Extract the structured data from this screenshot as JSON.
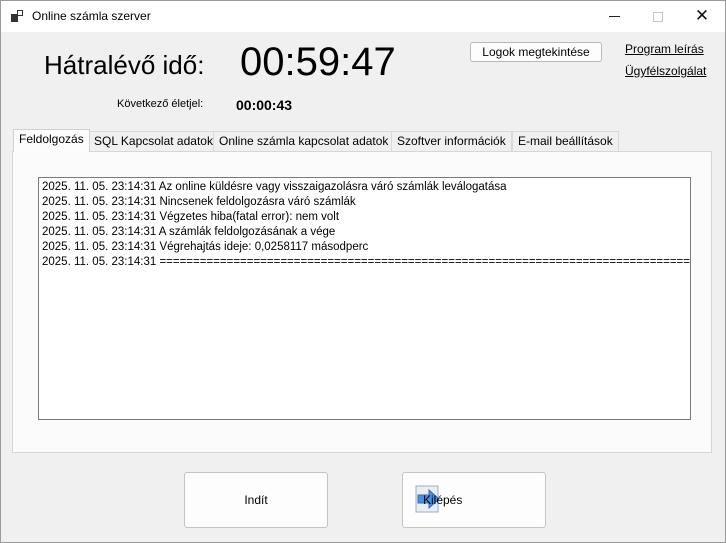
{
  "window": {
    "title": "Online számla szerver",
    "controls": [
      "minimize",
      "maximize",
      "close"
    ]
  },
  "header": {
    "remaining_time_label": "Hátralévő idő:",
    "remaining_time_value": "00:59:47",
    "next_heartbeat_label": "Következő életjel:",
    "next_heartbeat_value": "00:00:43",
    "view_logs_button": "Logok megtekintése",
    "program_description_link": "Program leírás",
    "customer_service_link": "Ügyfélszolgálat"
  },
  "tabs": [
    {
      "label": "Feldolgozás",
      "active": true
    },
    {
      "label": "SQL Kapcsolat adatok",
      "active": false
    },
    {
      "label": "Online számla kapcsolat adatok",
      "active": false
    },
    {
      "label": "Szoftver információk",
      "active": false
    },
    {
      "label": "E-mail beállítások",
      "active": false
    }
  ],
  "log": [
    "2025. 11. 05. 23:14:31 Az online küldésre vagy visszaigazolásra váró számlák leválogatása",
    "2025. 11. 05. 23:14:31 Nincsenek feldolgozásra váró számlák",
    "2025. 11. 05. 23:14:31 Végzetes hiba(fatal error):  nem volt",
    "2025. 11. 05. 23:14:31 A számlák feldolgozásának a vége",
    "2025. 11. 05. 23:14:31 Végrehajtás ideje: 0,0258117 másodperc",
    "2025. 11. 05. 23:14:31 ==============================================================================="
  ],
  "buttons": {
    "start": "Indít",
    "exit": "Kilépés"
  },
  "colors": {
    "background": "#f0f0f0",
    "titlebar": "#ffffff",
    "exit_icon_blue": "#4a90e2"
  },
  "icons": {
    "app": "app-icon",
    "exit": "exit-arrow-icon"
  }
}
